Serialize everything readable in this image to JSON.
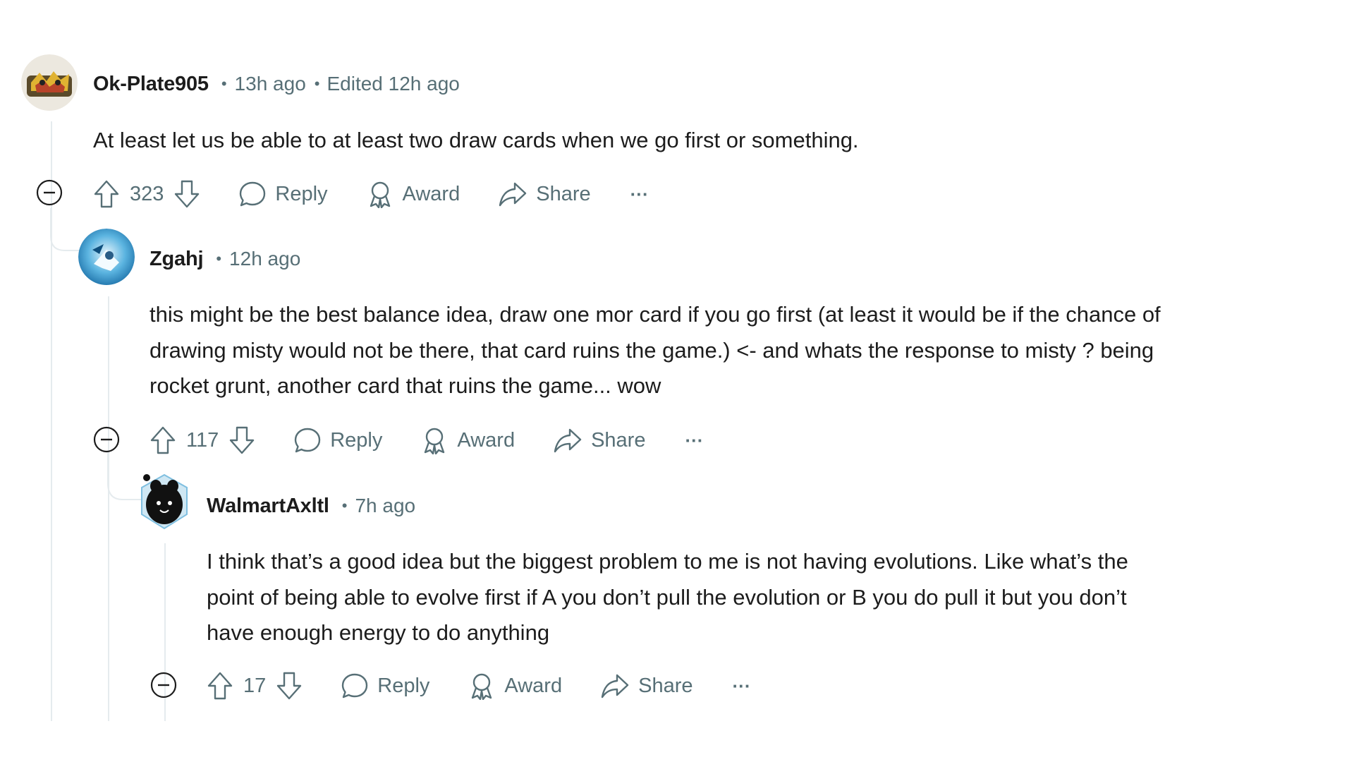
{
  "comments": [
    {
      "username": "Ok-Plate905",
      "time": "13h ago",
      "edited": "Edited 12h ago",
      "body": "At least let us be able to at least two draw cards when we go first or something.",
      "votes": "323",
      "actions": {
        "reply": "Reply",
        "award": "Award",
        "share": "Share",
        "more": "···"
      }
    },
    {
      "username": "Zgahj",
      "time": "12h ago",
      "body_lines": [
        "this might be the best balance idea, draw one mor card if you go first (at least it would be if the chance of",
        "drawing misty would not be there, that card ruins the game.) <- and whats the response to misty ? being",
        "rocket grunt, another card that ruins the game... wow"
      ],
      "votes": "117",
      "actions": {
        "reply": "Reply",
        "award": "Award",
        "share": "Share",
        "more": "···"
      }
    },
    {
      "username": "WalmartAxltl",
      "time": "7h ago",
      "body_lines": [
        "I think that’s a good idea but the biggest problem to me is not having evolutions. Like what’s the",
        "point of being able to evolve first if A you don’t pull the evolution or B you do pull it but you don’t",
        "have enough energy to do anything"
      ],
      "votes": "17",
      "actions": {
        "reply": "Reply",
        "award": "Award",
        "share": "Share",
        "more": "···"
      }
    }
  ],
  "icons": {
    "upvote": "arrow-up-icon",
    "downvote": "arrow-down-icon",
    "reply": "speech-bubble-icon",
    "award": "award-ribbon-icon",
    "share": "share-arrow-icon",
    "collapse": "minus-circle-icon",
    "more": "ellipsis-icon"
  },
  "colors": {
    "text": "#1c1c1c",
    "meta": "#576f76",
    "thread_line": "#e5ebee"
  }
}
